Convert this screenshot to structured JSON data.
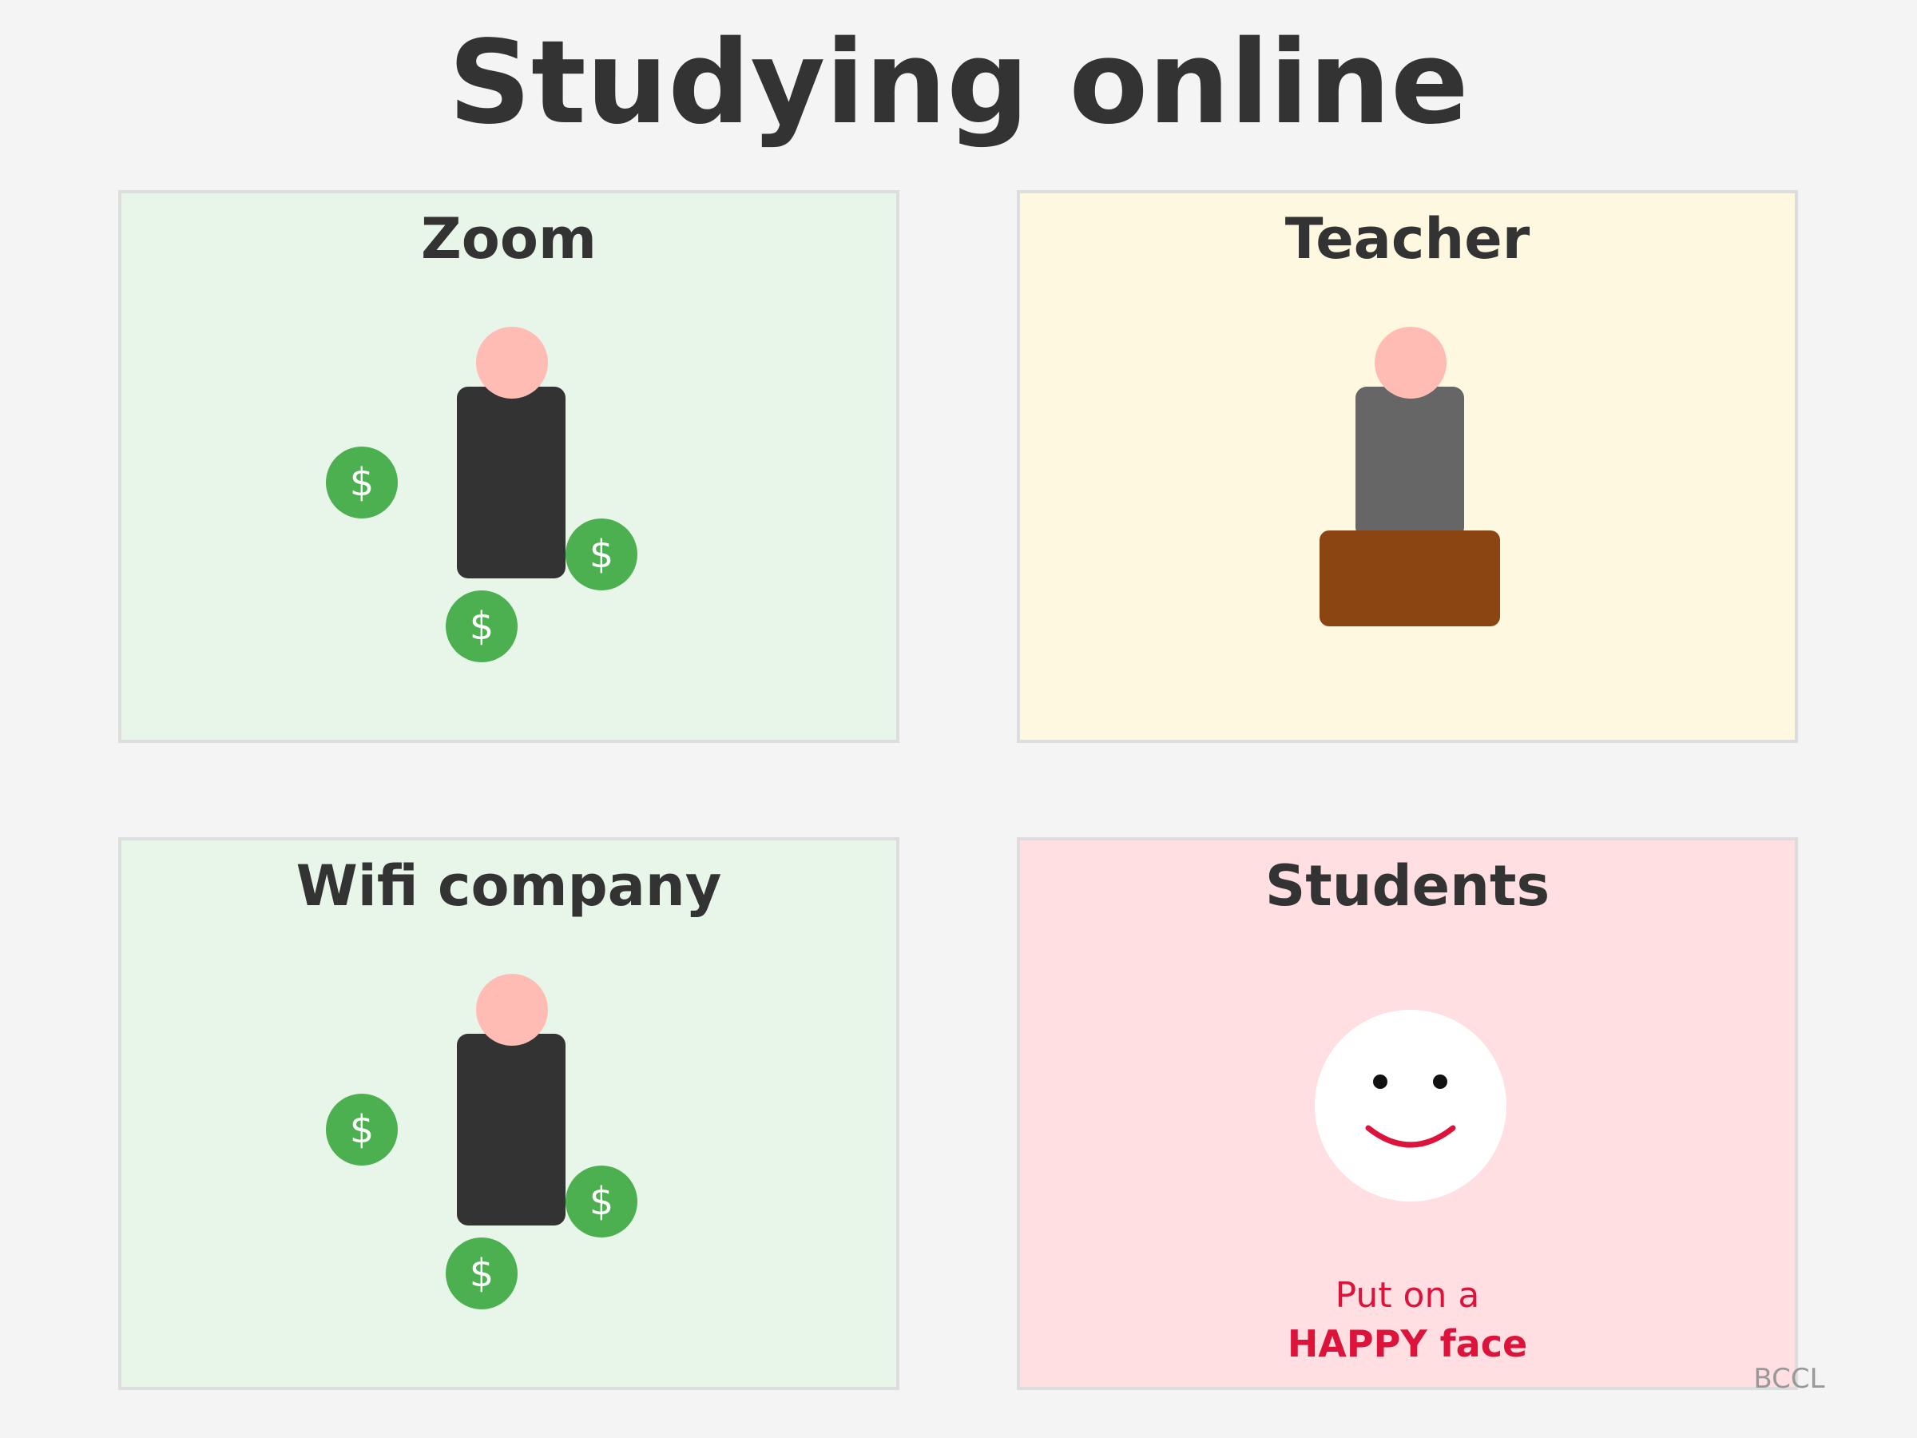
{
  "title": "Studying online",
  "colors": {
    "background": "#f4f4f4",
    "panel_green": "#e8f5e9",
    "panel_yellow": "#fef8e0",
    "panel_pink": "#ffdfe2",
    "coin": "#4caf50",
    "skin": "#ffbcb4",
    "body_dark": "#333333",
    "body_grey": "#666666",
    "podium": "#8b4513",
    "smile": "#dc143c"
  },
  "panels": {
    "zoom": {
      "title": "Zoom",
      "coin_symbol": "$",
      "icons": [
        "person-icon",
        "dollar-coin-icon"
      ]
    },
    "teacher": {
      "title": "Teacher",
      "icons": [
        "person-icon",
        "podium-icon"
      ]
    },
    "wifi": {
      "title": "Wifi company",
      "coin_symbol": "$",
      "icons": [
        "person-icon",
        "dollar-coin-icon"
      ]
    },
    "students": {
      "title": "Students",
      "icons": [
        "smiley-face-icon"
      ],
      "caption_line1": "Put on a",
      "caption_line2": "HAPPY face"
    }
  },
  "footer": {
    "credit": "BCCL"
  }
}
